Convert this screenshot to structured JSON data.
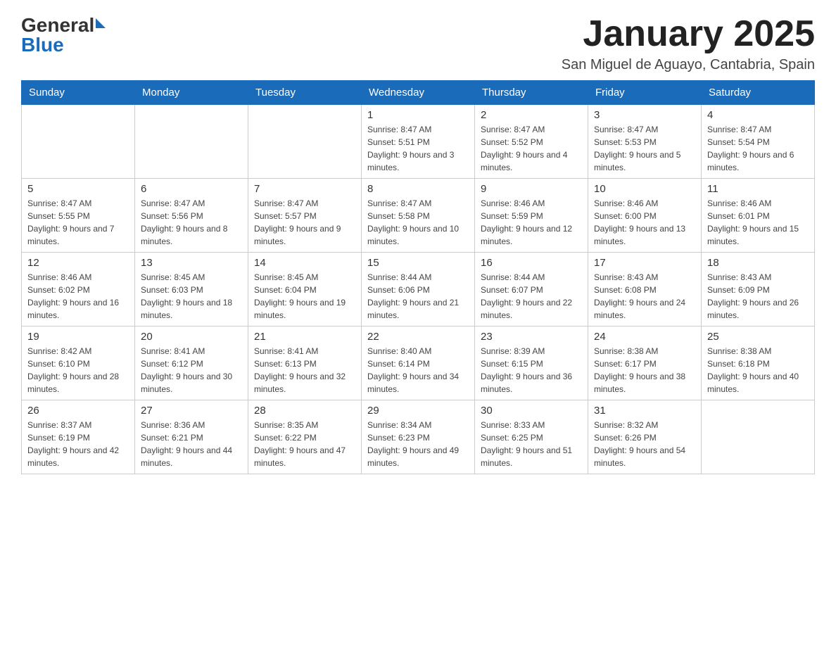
{
  "header": {
    "logo_general": "General",
    "logo_blue": "Blue",
    "title": "January 2025",
    "subtitle": "San Miguel de Aguayo, Cantabria, Spain"
  },
  "weekdays": [
    "Sunday",
    "Monday",
    "Tuesday",
    "Wednesday",
    "Thursday",
    "Friday",
    "Saturday"
  ],
  "weeks": [
    [
      {
        "day": "",
        "info": ""
      },
      {
        "day": "",
        "info": ""
      },
      {
        "day": "",
        "info": ""
      },
      {
        "day": "1",
        "info": "Sunrise: 8:47 AM\nSunset: 5:51 PM\nDaylight: 9 hours and 3 minutes."
      },
      {
        "day": "2",
        "info": "Sunrise: 8:47 AM\nSunset: 5:52 PM\nDaylight: 9 hours and 4 minutes."
      },
      {
        "day": "3",
        "info": "Sunrise: 8:47 AM\nSunset: 5:53 PM\nDaylight: 9 hours and 5 minutes."
      },
      {
        "day": "4",
        "info": "Sunrise: 8:47 AM\nSunset: 5:54 PM\nDaylight: 9 hours and 6 minutes."
      }
    ],
    [
      {
        "day": "5",
        "info": "Sunrise: 8:47 AM\nSunset: 5:55 PM\nDaylight: 9 hours and 7 minutes."
      },
      {
        "day": "6",
        "info": "Sunrise: 8:47 AM\nSunset: 5:56 PM\nDaylight: 9 hours and 8 minutes."
      },
      {
        "day": "7",
        "info": "Sunrise: 8:47 AM\nSunset: 5:57 PM\nDaylight: 9 hours and 9 minutes."
      },
      {
        "day": "8",
        "info": "Sunrise: 8:47 AM\nSunset: 5:58 PM\nDaylight: 9 hours and 10 minutes."
      },
      {
        "day": "9",
        "info": "Sunrise: 8:46 AM\nSunset: 5:59 PM\nDaylight: 9 hours and 12 minutes."
      },
      {
        "day": "10",
        "info": "Sunrise: 8:46 AM\nSunset: 6:00 PM\nDaylight: 9 hours and 13 minutes."
      },
      {
        "day": "11",
        "info": "Sunrise: 8:46 AM\nSunset: 6:01 PM\nDaylight: 9 hours and 15 minutes."
      }
    ],
    [
      {
        "day": "12",
        "info": "Sunrise: 8:46 AM\nSunset: 6:02 PM\nDaylight: 9 hours and 16 minutes."
      },
      {
        "day": "13",
        "info": "Sunrise: 8:45 AM\nSunset: 6:03 PM\nDaylight: 9 hours and 18 minutes."
      },
      {
        "day": "14",
        "info": "Sunrise: 8:45 AM\nSunset: 6:04 PM\nDaylight: 9 hours and 19 minutes."
      },
      {
        "day": "15",
        "info": "Sunrise: 8:44 AM\nSunset: 6:06 PM\nDaylight: 9 hours and 21 minutes."
      },
      {
        "day": "16",
        "info": "Sunrise: 8:44 AM\nSunset: 6:07 PM\nDaylight: 9 hours and 22 minutes."
      },
      {
        "day": "17",
        "info": "Sunrise: 8:43 AM\nSunset: 6:08 PM\nDaylight: 9 hours and 24 minutes."
      },
      {
        "day": "18",
        "info": "Sunrise: 8:43 AM\nSunset: 6:09 PM\nDaylight: 9 hours and 26 minutes."
      }
    ],
    [
      {
        "day": "19",
        "info": "Sunrise: 8:42 AM\nSunset: 6:10 PM\nDaylight: 9 hours and 28 minutes."
      },
      {
        "day": "20",
        "info": "Sunrise: 8:41 AM\nSunset: 6:12 PM\nDaylight: 9 hours and 30 minutes."
      },
      {
        "day": "21",
        "info": "Sunrise: 8:41 AM\nSunset: 6:13 PM\nDaylight: 9 hours and 32 minutes."
      },
      {
        "day": "22",
        "info": "Sunrise: 8:40 AM\nSunset: 6:14 PM\nDaylight: 9 hours and 34 minutes."
      },
      {
        "day": "23",
        "info": "Sunrise: 8:39 AM\nSunset: 6:15 PM\nDaylight: 9 hours and 36 minutes."
      },
      {
        "day": "24",
        "info": "Sunrise: 8:38 AM\nSunset: 6:17 PM\nDaylight: 9 hours and 38 minutes."
      },
      {
        "day": "25",
        "info": "Sunrise: 8:38 AM\nSunset: 6:18 PM\nDaylight: 9 hours and 40 minutes."
      }
    ],
    [
      {
        "day": "26",
        "info": "Sunrise: 8:37 AM\nSunset: 6:19 PM\nDaylight: 9 hours and 42 minutes."
      },
      {
        "day": "27",
        "info": "Sunrise: 8:36 AM\nSunset: 6:21 PM\nDaylight: 9 hours and 44 minutes."
      },
      {
        "day": "28",
        "info": "Sunrise: 8:35 AM\nSunset: 6:22 PM\nDaylight: 9 hours and 47 minutes."
      },
      {
        "day": "29",
        "info": "Sunrise: 8:34 AM\nSunset: 6:23 PM\nDaylight: 9 hours and 49 minutes."
      },
      {
        "day": "30",
        "info": "Sunrise: 8:33 AM\nSunset: 6:25 PM\nDaylight: 9 hours and 51 minutes."
      },
      {
        "day": "31",
        "info": "Sunrise: 8:32 AM\nSunset: 6:26 PM\nDaylight: 9 hours and 54 minutes."
      },
      {
        "day": "",
        "info": ""
      }
    ]
  ]
}
